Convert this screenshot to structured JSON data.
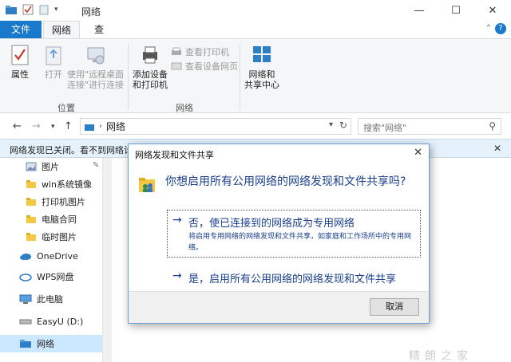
{
  "window": {
    "title": "网络",
    "minimize": "—",
    "maximize": "☐",
    "close": "✕"
  },
  "tabs": {
    "file": "文件",
    "network": "网络",
    "view": "查看"
  },
  "ribbon": {
    "properties": "属性",
    "open": "打开",
    "remote_desktop_line1": "使用\"远程桌面",
    "remote_desktop_line2": "连接\"进行连接",
    "location_group": "位置",
    "add_devices_line1": "添加设备",
    "add_devices_line2": "和打印机",
    "view_printers": "查看打印机",
    "view_device_webpage": "查看设备网页",
    "network_group": "网络",
    "network_center_line1": "网络和",
    "network_center_line2": "共享中心"
  },
  "address": {
    "path": "网络",
    "search_placeholder": "搜索\"网络\""
  },
  "infobar": {
    "text": "网络发现已关闭。看不到网络计"
  },
  "sidebar": {
    "items": [
      {
        "label": "图片"
      },
      {
        "label": "win系统镜像"
      },
      {
        "label": "打印机图片"
      },
      {
        "label": "电脑合同"
      },
      {
        "label": "临时图片"
      },
      {
        "label": "OneDrive"
      },
      {
        "label": "WPS网盘"
      },
      {
        "label": "此电脑"
      },
      {
        "label": "EasyU (D:)"
      },
      {
        "label": "网络"
      }
    ]
  },
  "dialog": {
    "title": "网络发现和文件共享",
    "question": "你想启用所有公用网络的网络发现和文件共享吗?",
    "option1_main": "否，使已连接到的网络成为专用网络",
    "option1_sub": "将启用专用网络的网络发现和文件共享，如家庭和工作场所中的专用网络。",
    "option2_main": "是，启用所有公用网络的网络发现和文件共享",
    "cancel": "取消"
  },
  "watermark": "精朗之家",
  "colors": {
    "accent": "#1979ca",
    "dialog_text": "#1a3e8c",
    "selection": "#cce8ff"
  }
}
